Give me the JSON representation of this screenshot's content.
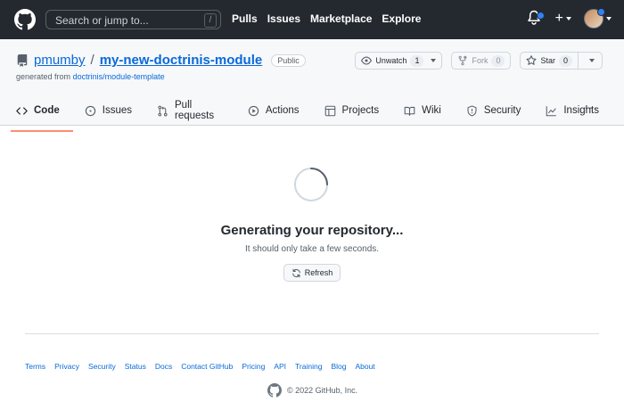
{
  "header": {
    "search_placeholder": "Search or jump to...",
    "search_shortcut": "/",
    "nav": [
      "Pulls",
      "Issues",
      "Marketplace",
      "Explore"
    ]
  },
  "repo": {
    "owner": "pmumby",
    "separator": "/",
    "name": "my-new-doctrinis-module",
    "visibility": "Public",
    "generated_prefix": "generated from",
    "generated_from": "doctrinis/module-template",
    "watch": {
      "label": "Unwatch",
      "count": "1"
    },
    "fork": {
      "label": "Fork",
      "count": "0"
    },
    "star": {
      "label": "Star",
      "count": "0"
    }
  },
  "tabs": [
    {
      "label": "Code",
      "icon": "code-icon",
      "active": true
    },
    {
      "label": "Issues",
      "icon": "issue-icon"
    },
    {
      "label": "Pull requests",
      "icon": "pull-request-icon"
    },
    {
      "label": "Actions",
      "icon": "play-icon"
    },
    {
      "label": "Projects",
      "icon": "project-table-icon"
    },
    {
      "label": "Wiki",
      "icon": "book-icon"
    },
    {
      "label": "Security",
      "icon": "shield-icon"
    },
    {
      "label": "Insights",
      "icon": "graph-icon"
    }
  ],
  "more_label": "···",
  "main": {
    "heading": "Generating your repository...",
    "subtext": "It should only take a few seconds.",
    "refresh_label": "Refresh"
  },
  "footer": {
    "links": [
      "Terms",
      "Privacy",
      "Security",
      "Status",
      "Docs",
      "Contact GitHub",
      "Pricing",
      "API",
      "Training",
      "Blog",
      "About"
    ],
    "copyright": "© 2022 GitHub, Inc."
  },
  "colors": {
    "header_bg": "#24292f",
    "link": "#0969da",
    "active_tab_underline": "#fd8c73",
    "notification_dot": "#2f81f7"
  }
}
